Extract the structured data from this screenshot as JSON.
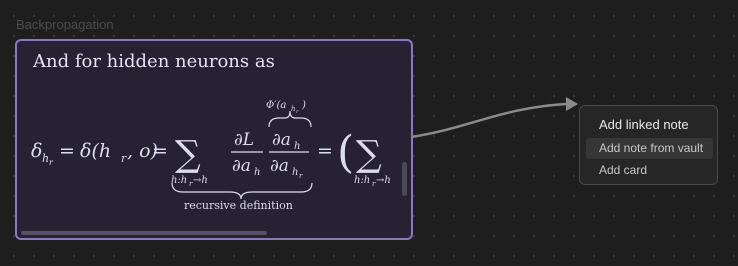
{
  "canvas": {
    "group_label": "Backpropagation"
  },
  "card": {
    "heading": "And for hidden neurons as",
    "formula": {
      "lhs": "δ",
      "lhs_sub": "h",
      "lhs_subsub": "r",
      "eq1": "=",
      "delta_args": "δ(h",
      "delta_args_sub": "r",
      "delta_args_tail": ", o)",
      "eq2": "=",
      "sum": "∑",
      "sum_index": "h:h",
      "sum_index_sub": "r",
      "sum_index_tail": "→h",
      "frac1_num": "∂L",
      "frac1_den": "∂a",
      "frac1_den_sub": "h",
      "frac2_num": "∂a",
      "frac2_num_sub": "h",
      "frac2_den": "∂a",
      "frac2_den_sub": "h",
      "frac2_den_subsub": "r",
      "overbrace_label": "Φ′(a",
      "overbrace_sub": "h",
      "overbrace_subsub": "r",
      "overbrace_close": ")",
      "underbrace_label": "recursive definition",
      "eq3": "=",
      "paren": "(",
      "sum2": "∑",
      "sum2_index": "h:h",
      "sum2_index_sub": "r",
      "sum2_index_tail": "→h"
    }
  },
  "context_menu": {
    "title": "Add linked note",
    "items": [
      {
        "label": "Add note from vault",
        "highlighted": true
      },
      {
        "label": "Add card",
        "highlighted": false
      }
    ]
  },
  "colors": {
    "card_border": "#8b76c8",
    "card_bg": "#262233",
    "connector": "#8a8a8a"
  }
}
